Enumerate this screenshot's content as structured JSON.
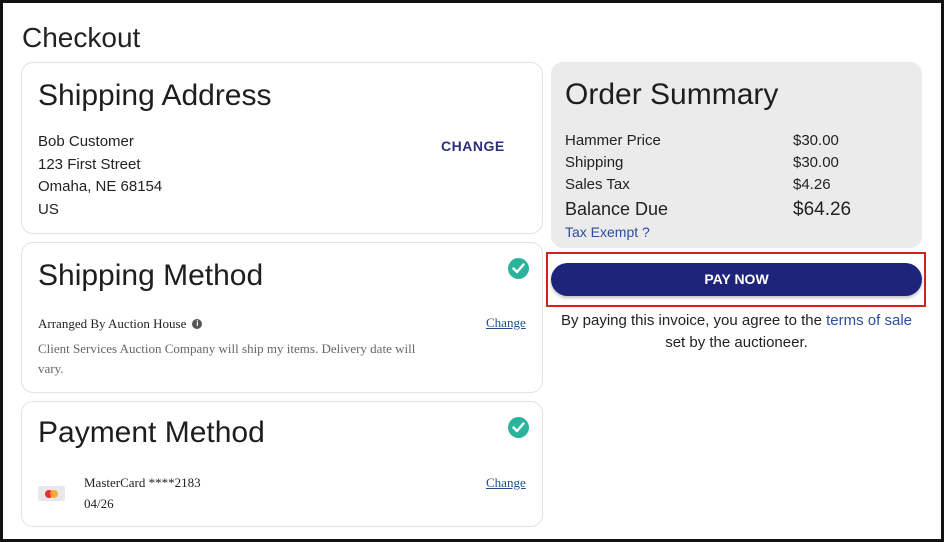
{
  "page": {
    "title": "Checkout"
  },
  "shipping_address": {
    "heading": "Shipping Address",
    "name": "Bob Customer",
    "street": "123 First Street",
    "city_line": "Omaha, NE 68154",
    "country": "US",
    "change_label": "CHANGE"
  },
  "shipping_method": {
    "heading": "Shipping Method",
    "method": "Arranged By Auction House",
    "description": "Client Services Auction Company will ship my items. Delivery date will vary.",
    "change_label": "Change",
    "info_icon": "i"
  },
  "payment_method": {
    "heading": "Payment Method",
    "card": "MasterCard ****2183",
    "expiry": "04/26",
    "change_label": "Change"
  },
  "order_summary": {
    "heading": "Order Summary",
    "rows": [
      {
        "label": "Hammer Price",
        "value": "$30.00"
      },
      {
        "label": "Shipping",
        "value": "$30.00"
      },
      {
        "label": "Sales Tax",
        "value": "$4.26"
      }
    ],
    "balance_label": "Balance Due",
    "balance_value": "$64.26",
    "tax_exempt": "Tax Exempt ?"
  },
  "pay_button": {
    "label": "PAY NOW"
  },
  "terms": {
    "prefix": "By paying this invoice, you agree to the",
    "link": "terms of sale",
    "suffix": "set by the auctioneer."
  },
  "colors": {
    "accent": "#1d247a",
    "check": "#2bb39c",
    "highlight": "#d42020",
    "link": "#2b4d9a"
  },
  "icons": [
    "check-circle-icon",
    "info-icon",
    "mastercard-icon"
  ]
}
